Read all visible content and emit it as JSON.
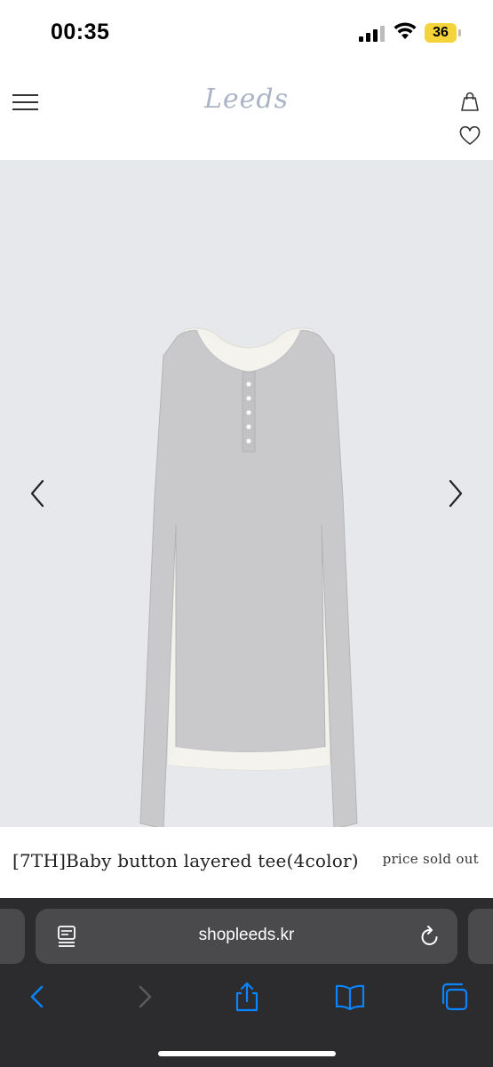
{
  "status_bar": {
    "time": "00:35",
    "battery_level": "36",
    "icons": [
      "cellular-signal-icon",
      "wifi-icon",
      "battery-icon"
    ],
    "battery_color": "#f5d33b"
  },
  "header": {
    "logo_text": "Leeds",
    "logo_color": "#aab4c6",
    "icons": [
      "hamburger-menu-icon",
      "shopping-bag-icon",
      "heart-icon"
    ]
  },
  "gallery": {
    "background_color": "#e7e8ec",
    "icons": [
      "chevron-left-icon",
      "chevron-right-icon"
    ],
    "image": "grey layered long-sleeve henley tee with white inner layer"
  },
  "product": {
    "name": "[7TH]Baby button layered tee(4color)",
    "price_status": "price sold out"
  },
  "browser": {
    "url": "shopleeds.kr",
    "accent_color": "#0a84ff",
    "bar_color": "#2c2c2e",
    "icons": [
      "reader-mode-icon",
      "reload-icon",
      "back-icon",
      "forward-icon",
      "share-icon",
      "bookmarks-icon",
      "tabs-icon"
    ]
  }
}
